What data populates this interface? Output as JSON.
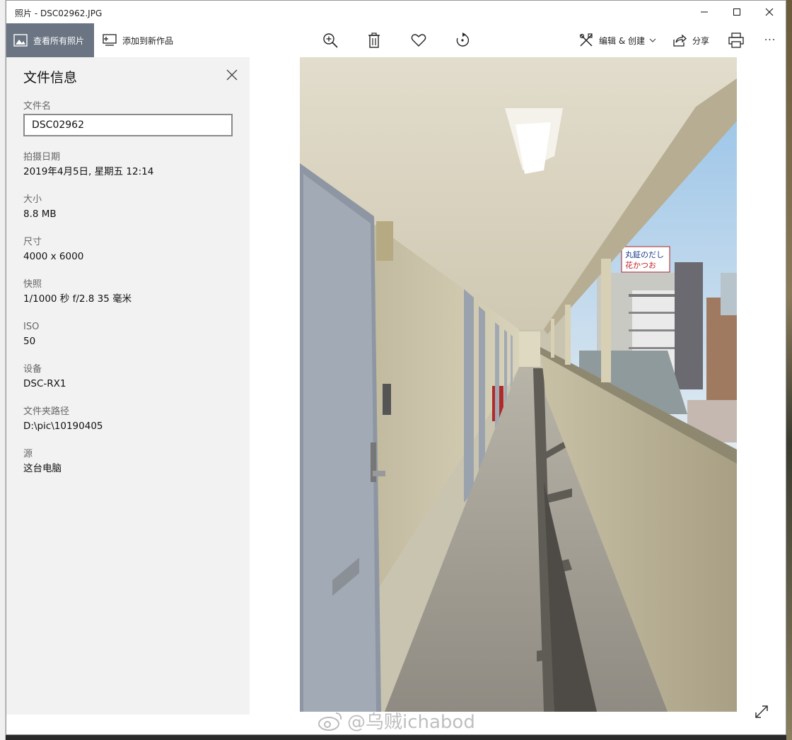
{
  "window": {
    "title": "照片 - DSC02962.JPG"
  },
  "toolbar": {
    "view_all_label": "查看所有照片",
    "add_creation_label": "添加到新作品",
    "edit_create_label": "编辑 & 创建",
    "share_label": "分享",
    "more_label": "···"
  },
  "panel": {
    "title": "文件信息",
    "filename_label": "文件名",
    "filename_value": "DSC02962",
    "date_label": "拍摄日期",
    "date_value": "2019年4月5日, 星期五 12:14",
    "size_label": "大小",
    "size_value": "8.8 MB",
    "dimensions_label": "尺寸",
    "dimensions_value": "4000 x 6000",
    "exposure_label": "快照",
    "exposure_value": "1/1000 秒 f/2.8 35 毫米",
    "iso_label": "ISO",
    "iso_value": "50",
    "device_label": "设备",
    "device_value": "DSC-RX1",
    "folder_label": "文件夹路径",
    "folder_value": "D:\\pic\\10190405",
    "source_label": "源",
    "source_value": "这台电脑"
  },
  "photo": {
    "sign_line1": "丸鉦のだし",
    "sign_line2": "花かつお"
  },
  "watermark": "@乌贼ichabod",
  "colors": {
    "view_all_bg": "#6a7482",
    "panel_bg": "#f2f2f2"
  }
}
